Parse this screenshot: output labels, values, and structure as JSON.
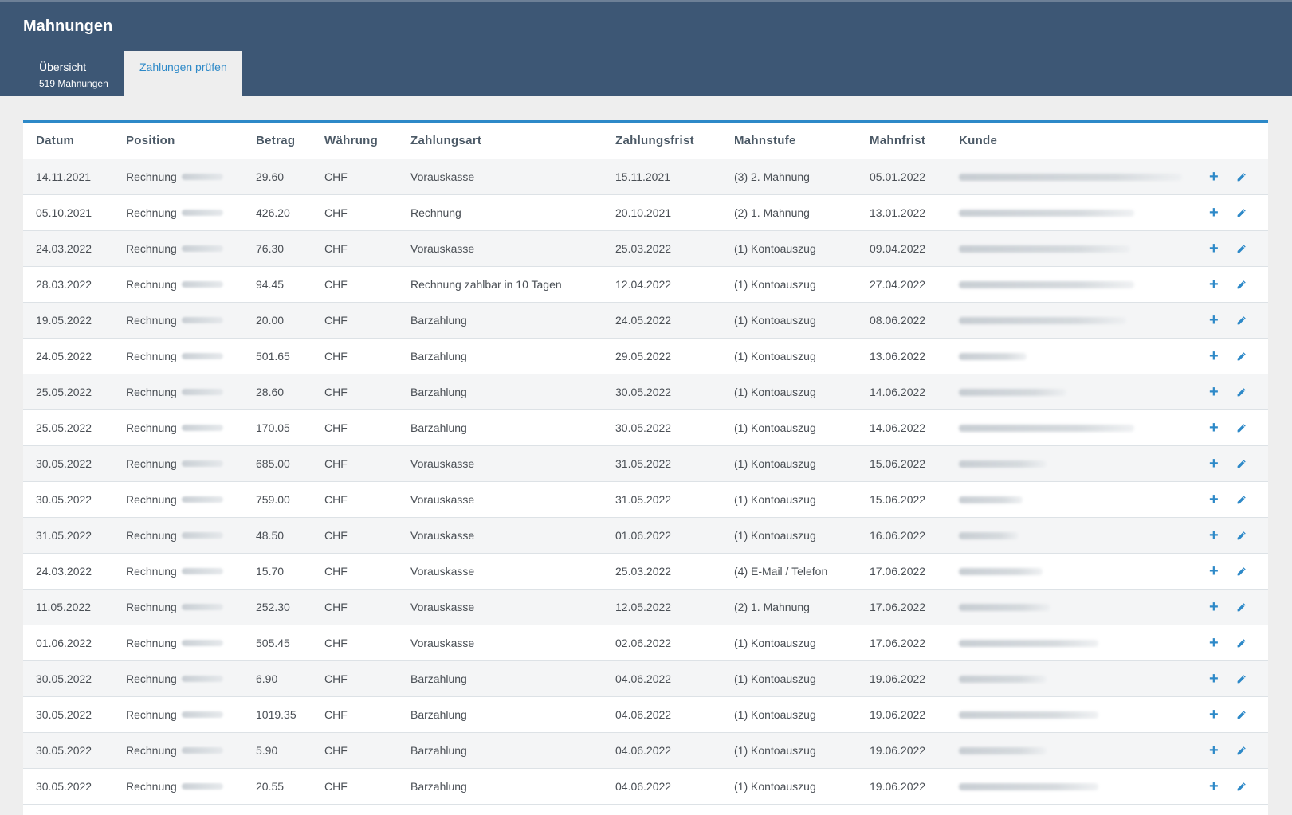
{
  "app": {
    "title": "Mahnungen"
  },
  "tabs": {
    "overview": {
      "label": "Übersicht",
      "sub": "519 Mahnungen"
    },
    "check": {
      "label": "Zahlungen prüfen"
    }
  },
  "colors": {
    "header_bg": "#3d5775",
    "accent": "#2d89c8"
  },
  "table": {
    "columns": {
      "datum": "Datum",
      "position": "Position",
      "betrag": "Betrag",
      "waehrung": "Währung",
      "zahlungsart": "Zahlungsart",
      "frist": "Zahlungsfrist",
      "stufe": "Mahnstufe",
      "mahnfrist": "Mahnfrist",
      "kunde": "Kunde"
    },
    "rows": [
      {
        "datum": "14.11.2021",
        "position": "Rechnung",
        "betrag": "29.60",
        "waehrung": "CHF",
        "zahlungsart": "Vorauskasse",
        "frist": "15.11.2021",
        "stufe": "(3) 2. Mahnung",
        "mahnfrist": "05.01.2022"
      },
      {
        "datum": "05.10.2021",
        "position": "Rechnung",
        "betrag": "426.20",
        "waehrung": "CHF",
        "zahlungsart": "Rechnung",
        "frist": "20.10.2021",
        "stufe": "(2) 1. Mahnung",
        "mahnfrist": "13.01.2022"
      },
      {
        "datum": "24.03.2022",
        "position": "Rechnung",
        "betrag": "76.30",
        "waehrung": "CHF",
        "zahlungsart": "Vorauskasse",
        "frist": "25.03.2022",
        "stufe": "(1) Kontoauszug",
        "mahnfrist": "09.04.2022"
      },
      {
        "datum": "28.03.2022",
        "position": "Rechnung",
        "betrag": "94.45",
        "waehrung": "CHF",
        "zahlungsart": "Rechnung zahlbar in 10 Tagen",
        "frist": "12.04.2022",
        "stufe": "(1) Kontoauszug",
        "mahnfrist": "27.04.2022"
      },
      {
        "datum": "19.05.2022",
        "position": "Rechnung",
        "betrag": "20.00",
        "waehrung": "CHF",
        "zahlungsart": "Barzahlung",
        "frist": "24.05.2022",
        "stufe": "(1) Kontoauszug",
        "mahnfrist": "08.06.2022"
      },
      {
        "datum": "24.05.2022",
        "position": "Rechnung",
        "betrag": "501.65",
        "waehrung": "CHF",
        "zahlungsart": "Barzahlung",
        "frist": "29.05.2022",
        "stufe": "(1) Kontoauszug",
        "mahnfrist": "13.06.2022"
      },
      {
        "datum": "25.05.2022",
        "position": "Rechnung",
        "betrag": "28.60",
        "waehrung": "CHF",
        "zahlungsart": "Barzahlung",
        "frist": "30.05.2022",
        "stufe": "(1) Kontoauszug",
        "mahnfrist": "14.06.2022"
      },
      {
        "datum": "25.05.2022",
        "position": "Rechnung",
        "betrag": "170.05",
        "waehrung": "CHF",
        "zahlungsart": "Barzahlung",
        "frist": "30.05.2022",
        "stufe": "(1) Kontoauszug",
        "mahnfrist": "14.06.2022"
      },
      {
        "datum": "30.05.2022",
        "position": "Rechnung",
        "betrag": "685.00",
        "waehrung": "CHF",
        "zahlungsart": "Vorauskasse",
        "frist": "31.05.2022",
        "stufe": "(1) Kontoauszug",
        "mahnfrist": "15.06.2022"
      },
      {
        "datum": "30.05.2022",
        "position": "Rechnung",
        "betrag": "759.00",
        "waehrung": "CHF",
        "zahlungsart": "Vorauskasse",
        "frist": "31.05.2022",
        "stufe": "(1) Kontoauszug",
        "mahnfrist": "15.06.2022"
      },
      {
        "datum": "31.05.2022",
        "position": "Rechnung",
        "betrag": "48.50",
        "waehrung": "CHF",
        "zahlungsart": "Vorauskasse",
        "frist": "01.06.2022",
        "stufe": "(1) Kontoauszug",
        "mahnfrist": "16.06.2022"
      },
      {
        "datum": "24.03.2022",
        "position": "Rechnung",
        "betrag": "15.70",
        "waehrung": "CHF",
        "zahlungsart": "Vorauskasse",
        "frist": "25.03.2022",
        "stufe": "(4) E-Mail / Telefon",
        "mahnfrist": "17.06.2022"
      },
      {
        "datum": "11.05.2022",
        "position": "Rechnung",
        "betrag": "252.30",
        "waehrung": "CHF",
        "zahlungsart": "Vorauskasse",
        "frist": "12.05.2022",
        "stufe": "(2) 1. Mahnung",
        "mahnfrist": "17.06.2022"
      },
      {
        "datum": "01.06.2022",
        "position": "Rechnung",
        "betrag": "505.45",
        "waehrung": "CHF",
        "zahlungsart": "Vorauskasse",
        "frist": "02.06.2022",
        "stufe": "(1) Kontoauszug",
        "mahnfrist": "17.06.2022"
      },
      {
        "datum": "30.05.2022",
        "position": "Rechnung",
        "betrag": "6.90",
        "waehrung": "CHF",
        "zahlungsart": "Barzahlung",
        "frist": "04.06.2022",
        "stufe": "(1) Kontoauszug",
        "mahnfrist": "19.06.2022"
      },
      {
        "datum": "30.05.2022",
        "position": "Rechnung",
        "betrag": "1019.35",
        "waehrung": "CHF",
        "zahlungsart": "Barzahlung",
        "frist": "04.06.2022",
        "stufe": "(1) Kontoauszug",
        "mahnfrist": "19.06.2022"
      },
      {
        "datum": "30.05.2022",
        "position": "Rechnung",
        "betrag": "5.90",
        "waehrung": "CHF",
        "zahlungsart": "Barzahlung",
        "frist": "04.06.2022",
        "stufe": "(1) Kontoauszug",
        "mahnfrist": "19.06.2022"
      },
      {
        "datum": "30.05.2022",
        "position": "Rechnung",
        "betrag": "20.55",
        "waehrung": "CHF",
        "zahlungsart": "Barzahlung",
        "frist": "04.06.2022",
        "stufe": "(1) Kontoauszug",
        "mahnfrist": "19.06.2022"
      }
    ],
    "actions": {
      "add_icon": "plus-icon",
      "edit_icon": "pencil-icon"
    }
  }
}
